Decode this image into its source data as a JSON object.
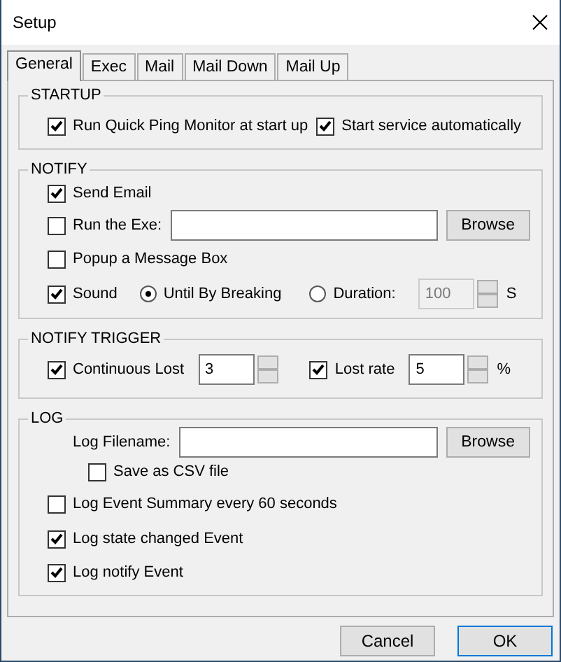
{
  "window": {
    "title": "Setup"
  },
  "tabs": [
    {
      "label": "General",
      "selected": true
    },
    {
      "label": "Exec",
      "selected": false
    },
    {
      "label": "Mail",
      "selected": false
    },
    {
      "label": "Mail Down",
      "selected": false
    },
    {
      "label": "Mail Up",
      "selected": false
    }
  ],
  "sections": [
    {
      "title": "STARTUP",
      "rows": [
        {
          "controls": [
            {
              "kind": "checkbox",
              "label": "Run Quick Ping Monitor at start up",
              "checked": true
            },
            {
              "kind": "checkbox",
              "label": "Start service automatically",
              "checked": true
            }
          ]
        }
      ]
    },
    {
      "title": "NOTIFY",
      "rows": [
        {
          "controls": [
            {
              "kind": "checkbox",
              "label": "Send Email",
              "checked": true
            }
          ]
        },
        {
          "controls": [
            {
              "kind": "checkbox",
              "label": "Run the Exe:",
              "checked": false
            },
            {
              "kind": "field"
            },
            {
              "kind": "button",
              "label": "Browse"
            }
          ]
        },
        {
          "controls": [
            {
              "kind": "checkbox",
              "label": "Popup a Message Box",
              "checked": false
            }
          ]
        },
        {
          "controls": [
            {
              "kind": "checkbox",
              "label": "Sound",
              "checked": true
            },
            {
              "kind": "radio",
              "label": "Until By Breaking",
              "selected": true
            },
            {
              "kind": "radio",
              "label": "Duration:",
              "selected": false
            },
            {
              "kind": "spinner",
              "value": "100",
              "disabled": true
            },
            {
              "kind": "label",
              "label": "S"
            }
          ]
        }
      ]
    },
    {
      "title": "NOTIFY TRIGGER",
      "rows": [
        {
          "controls": [
            {
              "kind": "checkbox",
              "label": "Continuous Lost",
              "checked": true
            },
            {
              "kind": "spinner",
              "value": "3",
              "disabled": false
            },
            {
              "kind": "checkbox",
              "label": "Lost rate",
              "checked": true
            },
            {
              "kind": "spinner",
              "value": "5",
              "disabled": false
            },
            {
              "kind": "label",
              "label": "%"
            }
          ]
        }
      ]
    },
    {
      "title": "LOG",
      "rows": [
        {
          "controls": [
            {
              "kind": "label",
              "label": "Log Filename:"
            },
            {
              "kind": "field"
            },
            {
              "kind": "button",
              "label": "Browse"
            }
          ]
        },
        {
          "controls": [
            {
              "kind": "checkbox",
              "label": "Save as CSV file",
              "checked": false
            }
          ]
        },
        {
          "controls": [
            {
              "kind": "checkbox",
              "label": "Log Event Summary every 60 seconds",
              "checked": false
            }
          ]
        },
        {
          "controls": [
            {
              "kind": "checkbox",
              "label": "Log state changed Event",
              "checked": true
            }
          ]
        },
        {
          "controls": [
            {
              "kind": "checkbox",
              "label": "Log notify Event",
              "checked": true
            }
          ]
        }
      ]
    }
  ],
  "buttons": [
    "Cancel",
    "OK"
  ]
}
